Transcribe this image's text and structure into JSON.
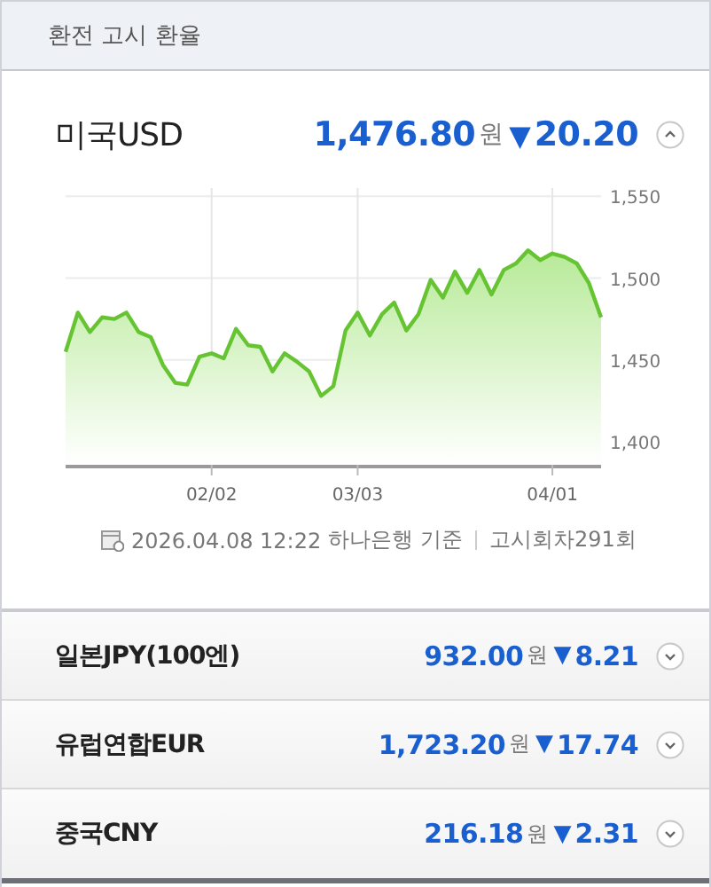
{
  "header": {
    "title": "환전 고시 환율"
  },
  "main": {
    "name": "미국USD",
    "rate": "1,476.80",
    "unit": "원",
    "arrow": "▼",
    "change": "20.20",
    "expanded": true,
    "chart_data": {
      "type": "area",
      "categories": [
        null,
        null,
        null,
        null,
        null,
        null,
        null,
        null,
        null,
        null,
        null,
        null,
        "02/02",
        null,
        null,
        null,
        null,
        null,
        null,
        null,
        null,
        null,
        null,
        null,
        "03/03",
        null,
        null,
        null,
        null,
        null,
        null,
        null,
        null,
        null,
        null,
        null,
        null,
        null,
        null,
        null,
        "04/01",
        null,
        null,
        null,
        null
      ],
      "values": [
        1455,
        1479,
        1467,
        1476,
        1475,
        1479,
        1467,
        1464,
        1447,
        1436,
        1435,
        1452,
        1454,
        1451,
        1469,
        1459,
        1458,
        1443,
        1454,
        1449,
        1443,
        1428,
        1434,
        1468,
        1479,
        1465,
        1478,
        1485,
        1468,
        1478,
        1499,
        1488,
        1504,
        1491,
        1505,
        1490,
        1505,
        1509,
        1517,
        1511,
        1515,
        1513,
        1509,
        1497,
        1476
      ],
      "ylim": [
        1386,
        1555
      ],
      "grid": true,
      "yticks": [
        {
          "value": 1400,
          "label": "1,400"
        },
        {
          "value": 1450,
          "label": "1,450"
        },
        {
          "value": 1500,
          "label": "1,500"
        },
        {
          "value": 1550,
          "label": "1,550"
        }
      ]
    },
    "footer": {
      "datetime": "2026.04.08 12:22",
      "bank": "하나은행 기준",
      "round": "고시회차291회"
    }
  },
  "others": [
    {
      "name": "일본JPY(100엔)",
      "rate": "932.00",
      "unit": "원",
      "arrow": "▼",
      "change": "8.21",
      "expanded": false
    },
    {
      "name": "유럽연합EUR",
      "rate": "1,723.20",
      "unit": "원",
      "arrow": "▼",
      "change": "17.74",
      "expanded": false
    },
    {
      "name": "중국CNY",
      "rate": "216.18",
      "unit": "원",
      "arrow": "▼",
      "change": "2.31",
      "expanded": false
    }
  ]
}
